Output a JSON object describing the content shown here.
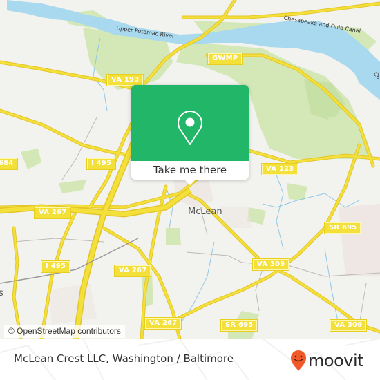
{
  "map": {
    "place_labels": [
      {
        "id": "mclean",
        "text": "McLean"
      }
    ],
    "water_labels": [
      {
        "id": "upper-potomac",
        "text": "Upper Potomac River"
      },
      {
        "id": "chesapeake-canal",
        "text": "Chesapeake and Ohio Canal"
      },
      {
        "id": "chesapeake-edge",
        "text": "Ch"
      }
    ],
    "road_shields": [
      {
        "id": "gwmp",
        "text": "GWMP"
      },
      {
        "id": "va193",
        "text": "VA 193"
      },
      {
        "id": "i495-north",
        "text": "I 495"
      },
      {
        "id": "va684-edge",
        "text": "684"
      },
      {
        "id": "va123",
        "text": "VA 123"
      },
      {
        "id": "va267-west",
        "text": "VA 267"
      },
      {
        "id": "sr695-east",
        "text": "SR 695"
      },
      {
        "id": "i495-south",
        "text": "I 495"
      },
      {
        "id": "va267-mid",
        "text": "VA 267"
      },
      {
        "id": "va309-mid",
        "text": "VA 309"
      },
      {
        "id": "va267-south",
        "text": "VA 267"
      },
      {
        "id": "sr695-south",
        "text": "SR 695"
      },
      {
        "id": "va309-east",
        "text": "VA 309"
      }
    ],
    "edge_label": "s",
    "attribution": "© OpenStreetMap contributors"
  },
  "popup": {
    "icon": "map-pin-icon",
    "cta_label": "Take me there",
    "color": "#22b768"
  },
  "footer": {
    "title": "McLean Crest LLC, Washington / Baltimore",
    "brand": "moovit",
    "brand_color": "#f05a28"
  },
  "colors": {
    "land": "#f2f2ef",
    "park": "#cfe6b0",
    "water": "#a9d9ee",
    "road": "#f4e03a",
    "road_casing": "#e3c52a"
  }
}
